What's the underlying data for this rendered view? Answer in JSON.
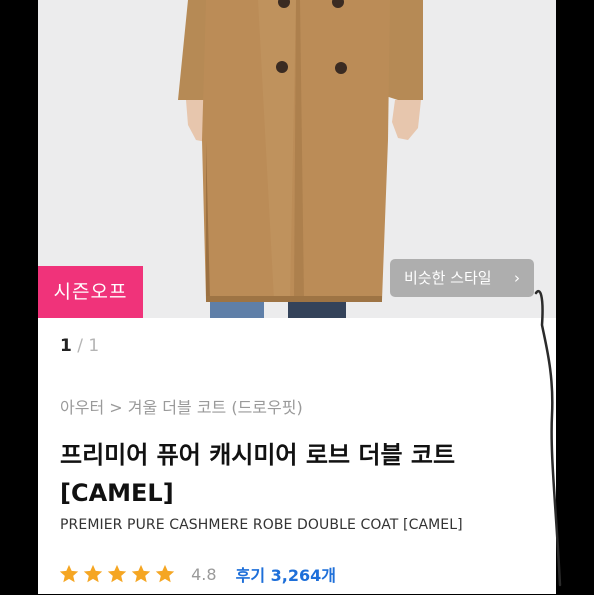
{
  "product": {
    "season_badge": "시즌오프",
    "similar_style_label": "비슷한 스타일",
    "similar_style_icon": "chevron-right-icon",
    "pager": {
      "current": "1",
      "separator": "/",
      "total": "1"
    },
    "breadcrumb": {
      "category": "아우터",
      "separator": ">",
      "subcategory": "겨울 더블 코트 (드로우핏)"
    },
    "title_line1": "프리미어 퓨어 캐시미어 로브 더블 코트",
    "title_line2": "[CAMEL]",
    "subtitle": "PREMIER PURE CASHMERE ROBE DOUBLE COAT [CAMEL]",
    "rating": {
      "stars": 5,
      "score": "4.8",
      "reviews": "후기 3,264개"
    }
  },
  "colors": {
    "accent_pink": "#f0337a",
    "star_orange": "#f5a623",
    "review_blue": "#1e6fd9",
    "coat_camel": "#b98b57"
  }
}
